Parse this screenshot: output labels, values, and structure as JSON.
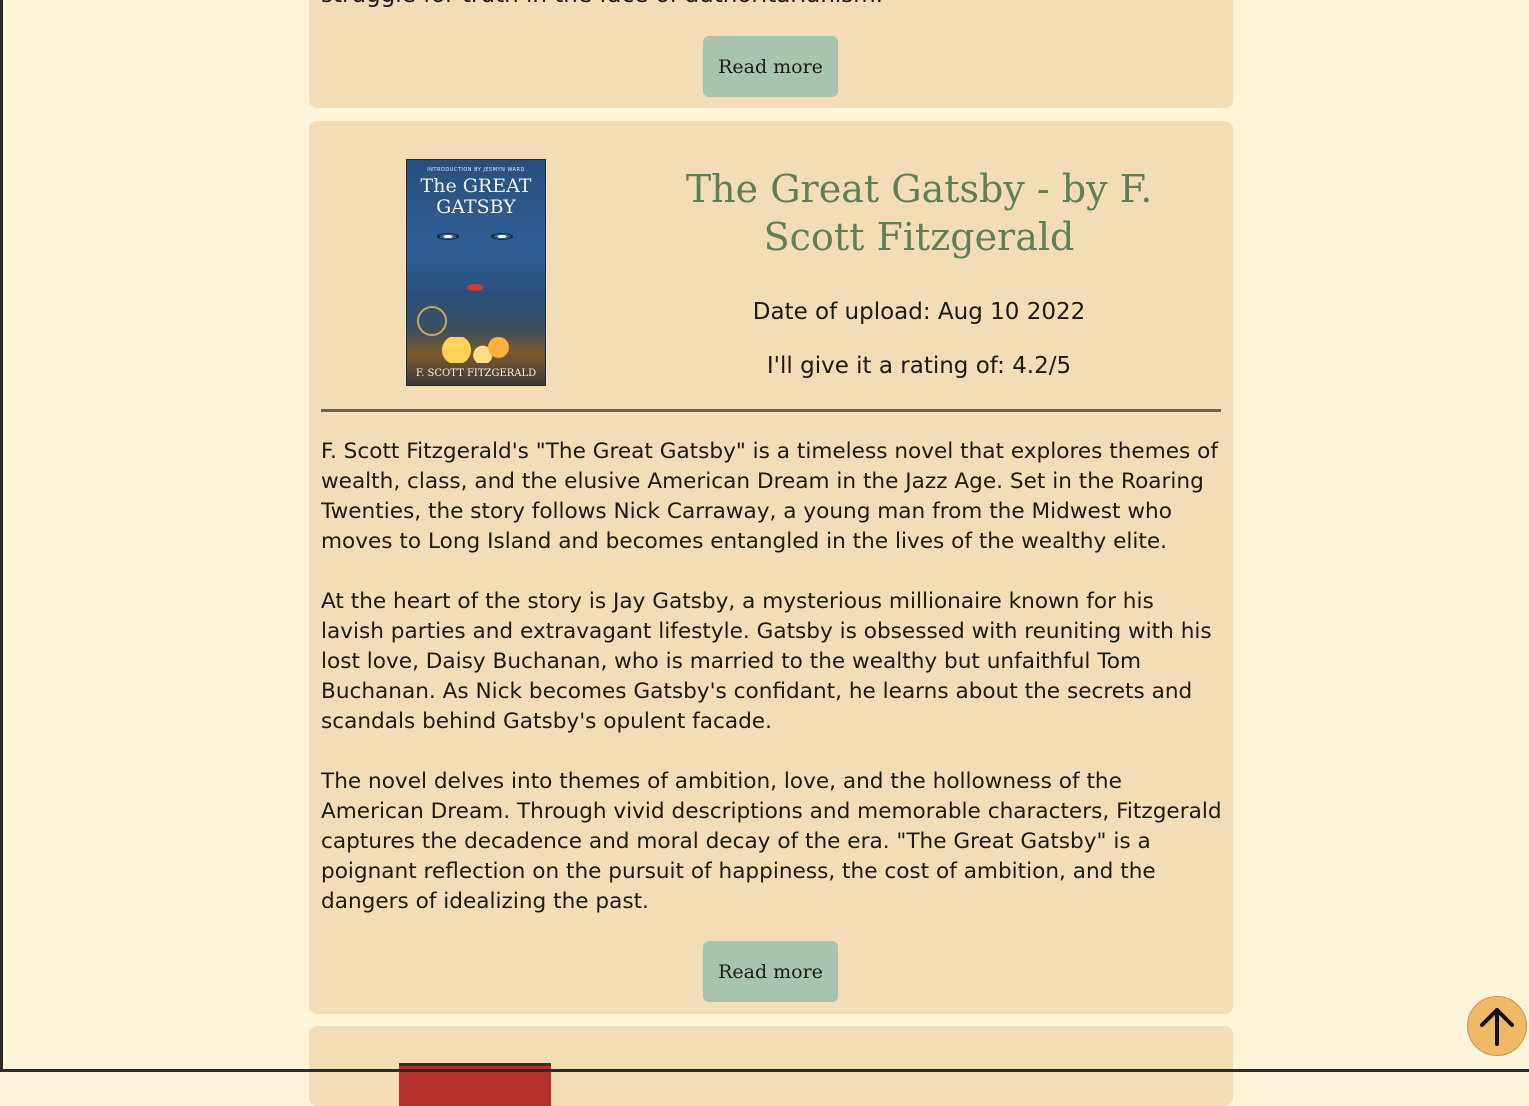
{
  "previous_review": {
    "text_tail": "struggle for truth in the face of authoritarianism.",
    "read_more_label": "Read more"
  },
  "review": {
    "cover": {
      "intro_text": "INTRODUCTION BY JESMYN WARD",
      "title_text": "The GREAT GATSBY",
      "author_text": "F. SCOTT FITZGERALD"
    },
    "title": "The Great Gatsby - by F. Scott Fitzgerald",
    "upload_date": "Date of upload: Aug 10 2022",
    "rating": "I'll give it a rating of: 4.2/5",
    "paragraphs": [
      "F. Scott Fitzgerald's \"The Great Gatsby\" is a timeless novel that explores themes of wealth, class, and the elusive American Dream in the Jazz Age. Set in the Roaring Twenties, the story follows Nick Carraway, a young man from the Midwest who moves to Long Island and becomes entangled in the lives of the wealthy elite.",
      "At the heart of the story is Jay Gatsby, a mysterious millionaire known for his lavish parties and extravagant lifestyle. Gatsby is obsessed with reuniting with his lost love, Daisy Buchanan, who is married to the wealthy but unfaithful Tom Buchanan. As Nick becomes Gatsby's confidant, he learns about the secrets and scandals behind Gatsby's opulent facade.",
      "The novel delves into themes of ambition, love, and the hollowness of the American Dream. Through vivid descriptions and memorable characters, Fitzgerald captures the decadence and moral decay of the era. \"The Great Gatsby\" is a poignant reflection on the pursuit of happiness, the cost of ambition, and the dangers of idealizing the past."
    ],
    "read_more_label": "Read more"
  },
  "scroll_top": {
    "icon": "arrow-up-icon"
  },
  "colors": {
    "page_background": "#fdf5da",
    "card_background": "#f2ddb7",
    "title_green": "#5e7f58",
    "button_green": "#a8c4ae",
    "scroll_button": "#f1b867"
  }
}
